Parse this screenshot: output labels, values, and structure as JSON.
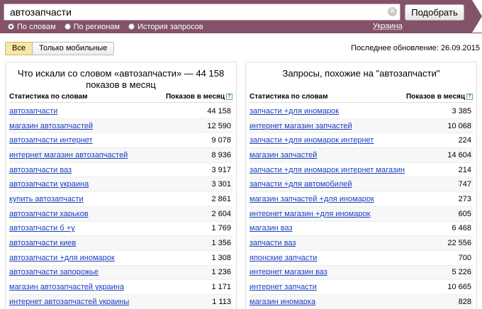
{
  "search": {
    "query": "автозапчасти",
    "clear_glyph": "✕",
    "submit_label": "Подобрать",
    "modes": [
      {
        "label": "По словам",
        "selected": true
      },
      {
        "label": "По регионам",
        "selected": false
      },
      {
        "label": "История запросов",
        "selected": false
      }
    ],
    "region": "Украина"
  },
  "filters": {
    "all_label": "Все",
    "mobile_label": "Только мобильные",
    "active": "all"
  },
  "last_update": "Последнее обновление: 26.09.2015",
  "left_panel": {
    "title": "Что искали со словом «автозапчасти» — 44 158 показов в месяц",
    "col_phrase": "Статистика по словам",
    "col_count": "Показов в месяц",
    "help_glyph": "?",
    "rows": [
      {
        "phrase": "автозапчасти",
        "count": "44 158"
      },
      {
        "phrase": "магазин автозапчастей",
        "count": "12 590"
      },
      {
        "phrase": "автозапчасти интернет",
        "count": "9 078"
      },
      {
        "phrase": "интернет магазин автозапчастей",
        "count": "8 936"
      },
      {
        "phrase": "автозапчасти ваз",
        "count": "3 917"
      },
      {
        "phrase": "автозапчасти украина",
        "count": "3 301"
      },
      {
        "phrase": "купить автозапчасти",
        "count": "2 861"
      },
      {
        "phrase": "автозапчасти харьков",
        "count": "2 604"
      },
      {
        "phrase": "автозапчасти б +у",
        "count": "1 769"
      },
      {
        "phrase": "автозапчасти киев",
        "count": "1 356"
      },
      {
        "phrase": "автозапчасти +для иномарок",
        "count": "1 308"
      },
      {
        "phrase": "автозапчасти запорожье",
        "count": "1 236"
      },
      {
        "phrase": "магазин автозапчастей украина",
        "count": "1 171"
      },
      {
        "phrase": "интернет автозапчастей украины",
        "count": "1 113"
      }
    ]
  },
  "right_panel": {
    "title": "Запросы, похожие на \"автозапчасти\"",
    "col_phrase": "Статистика по словам",
    "col_count": "Показов в месяц",
    "help_glyph": "?",
    "rows": [
      {
        "phrase": "запчасти +для иномарок",
        "count": "3 385"
      },
      {
        "phrase": "интернет магазин запчастей",
        "count": "10 068"
      },
      {
        "phrase": "запчасти +для иномарок интернет",
        "count": "224"
      },
      {
        "phrase": "магазин запчастей",
        "count": "14 604"
      },
      {
        "phrase": "запчасти +для иномарок интернет магазин",
        "count": "214"
      },
      {
        "phrase": "запчасти +для автомобилей",
        "count": "747"
      },
      {
        "phrase": "магазин запчастей +для иномарок",
        "count": "273"
      },
      {
        "phrase": "интернет магазин +для иномарок",
        "count": "605"
      },
      {
        "phrase": "магазин ваз",
        "count": "6 468"
      },
      {
        "phrase": "запчасти ваз",
        "count": "22 556"
      },
      {
        "phrase": "японские запчасти",
        "count": "700"
      },
      {
        "phrase": "интернет магазин ваз",
        "count": "5 226"
      },
      {
        "phrase": "интернет запчасти",
        "count": "10 665"
      },
      {
        "phrase": "магазин иномарка",
        "count": "828"
      }
    ]
  }
}
